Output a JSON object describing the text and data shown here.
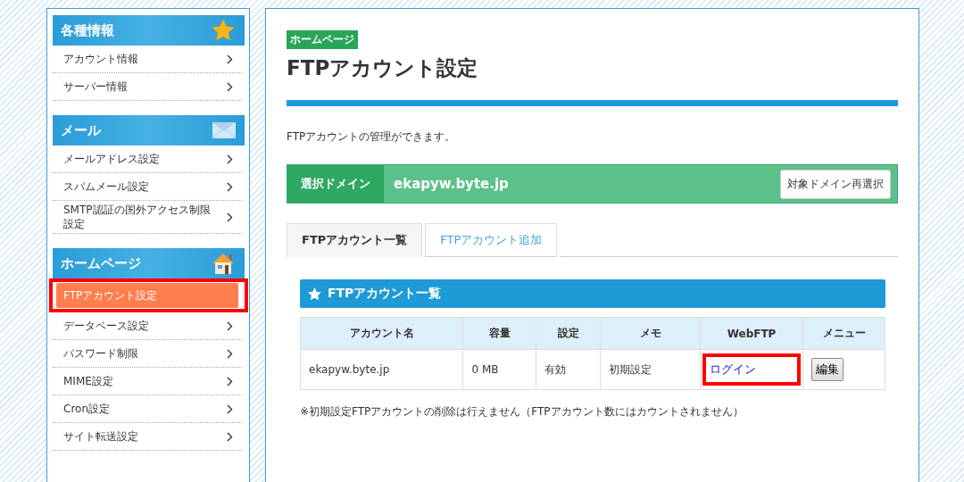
{
  "sidebar": {
    "sections": [
      {
        "title": "各種情報",
        "items": [
          {
            "label": "アカウント情報",
            "selected": false,
            "highlighted": false
          },
          {
            "label": "サーバー情報",
            "selected": false,
            "highlighted": false
          }
        ]
      },
      {
        "title": "メール",
        "items": [
          {
            "label": "メールアドレス設定",
            "selected": false,
            "highlighted": false
          },
          {
            "label": "スパムメール設定",
            "selected": false,
            "highlighted": false
          },
          {
            "label": "SMTP認証の国外アクセス制限設定",
            "selected": false,
            "highlighted": false
          }
        ]
      },
      {
        "title": "ホームページ",
        "items": [
          {
            "label": "FTPアカウント設定",
            "selected": true,
            "highlighted": true
          },
          {
            "label": "データベース設定",
            "selected": false,
            "highlighted": false
          },
          {
            "label": "パスワード制限",
            "selected": false,
            "highlighted": false
          },
          {
            "label": "MIME設定",
            "selected": false,
            "highlighted": false
          },
          {
            "label": "Cron設定",
            "selected": false,
            "highlighted": false
          },
          {
            "label": "サイト転送設定",
            "selected": false,
            "highlighted": false
          }
        ]
      }
    ]
  },
  "main": {
    "category_badge": "ホームページ",
    "title": "FTPアカウント設定",
    "description": "FTPアカウントの管理ができます。",
    "domain_bar": {
      "label": "選択ドメイン",
      "domain": "ekapyw.byte.jp",
      "button": "対象ドメイン再選択"
    },
    "tabs": [
      {
        "label": "FTPアカウント一覧",
        "selected": true
      },
      {
        "label": "FTPアカウント追加",
        "selected": false
      }
    ],
    "section_title": "FTPアカウント一覧",
    "table": {
      "columns": [
        "アカウント名",
        "容量",
        "設定",
        "メモ",
        "WebFTP",
        "メニュー"
      ],
      "rows": [
        {
          "account": "ekapyw.byte.jp",
          "capacity": "0 MB",
          "setting": "有効",
          "memo": "初期設定",
          "webftp": "ログイン",
          "webftp_highlighted": true,
          "menu": "編集"
        }
      ]
    },
    "note": "※初期設定FTPアカウントの削除は行えません（FTPアカウント数にはカウントされません）"
  }
}
